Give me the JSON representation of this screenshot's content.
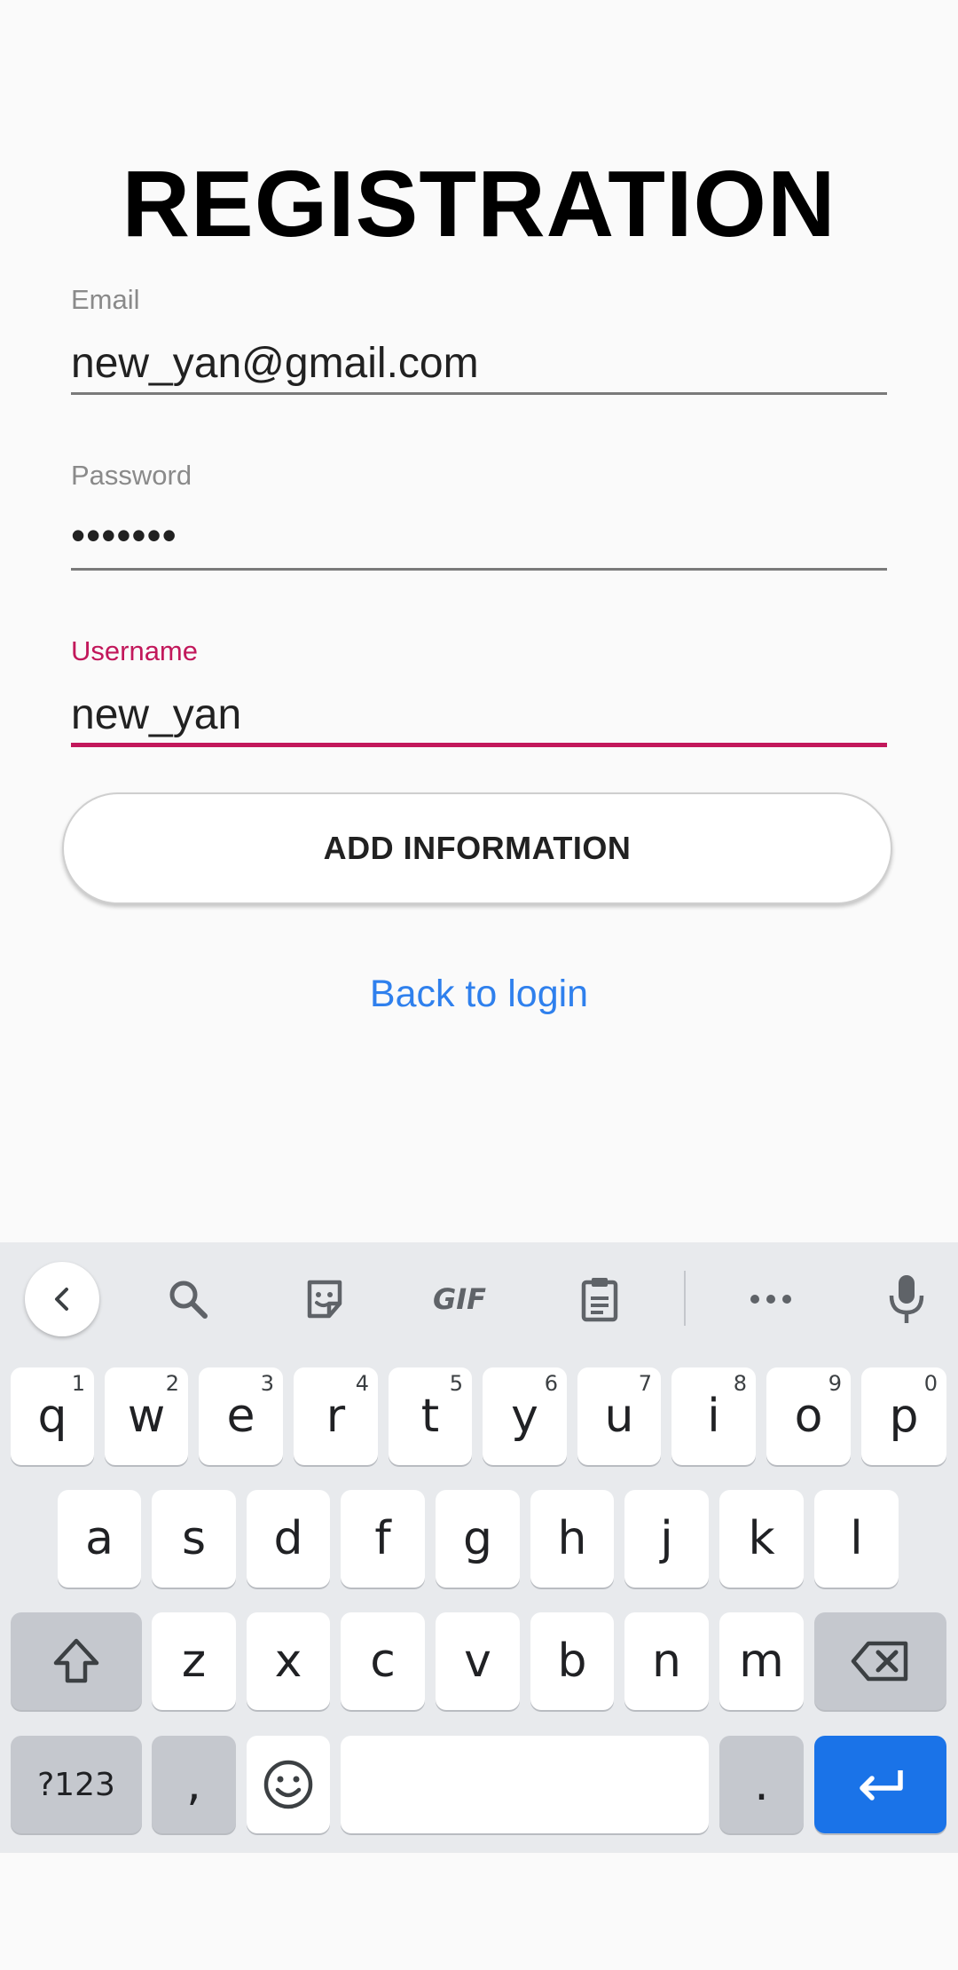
{
  "page": {
    "title": "REGISTRATION",
    "fields": [
      {
        "label": "Email",
        "value": "new_yan@gmail.com"
      },
      {
        "label": "Password",
        "value": "•••••••"
      },
      {
        "label": "Username",
        "value": "new_yan"
      }
    ],
    "add_button": "ADD INFORMATION",
    "back_link": "Back to login",
    "accent_color": "#c2185b",
    "link_color": "#2f80ed"
  },
  "keyboard": {
    "toolbar": [
      "back-icon",
      "search-icon",
      "sticker-icon",
      "gif-icon",
      "clipboard-icon",
      "more-icon",
      "mic-icon"
    ],
    "gif_label": "GIF",
    "row1": [
      "q",
      "w",
      "e",
      "r",
      "t",
      "y",
      "u",
      "i",
      "o",
      "p"
    ],
    "row1_hints": [
      "1",
      "2",
      "3",
      "4",
      "5",
      "6",
      "7",
      "8",
      "9",
      "0"
    ],
    "row2": [
      "a",
      "s",
      "d",
      "f",
      "g",
      "h",
      "j",
      "k",
      "l"
    ],
    "row3": [
      "z",
      "x",
      "c",
      "v",
      "b",
      "n",
      "m"
    ],
    "symbols_key": "?123",
    "comma_key": ",",
    "period_key": ".",
    "enter_color": "#1a73e8"
  }
}
